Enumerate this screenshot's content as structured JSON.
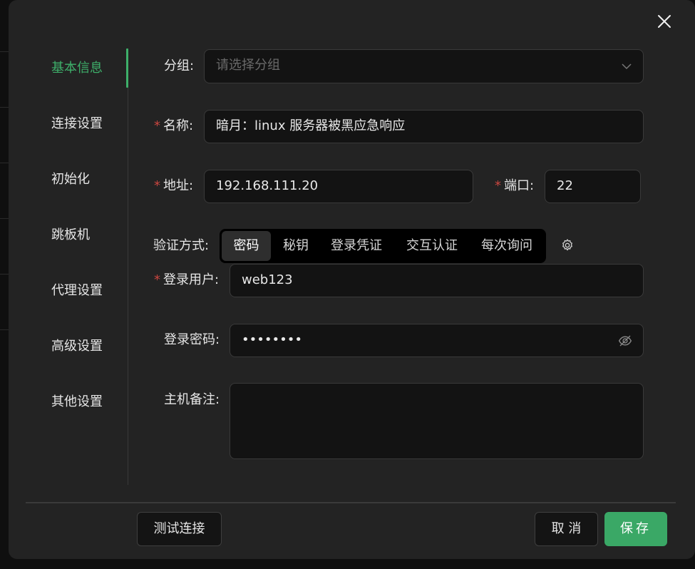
{
  "sidebar": {
    "items": [
      {
        "label": "基本信息",
        "active": true
      },
      {
        "label": "连接设置"
      },
      {
        "label": "初始化"
      },
      {
        "label": "跳板机"
      },
      {
        "label": "代理设置"
      },
      {
        "label": "高级设置"
      },
      {
        "label": "其他设置"
      }
    ]
  },
  "form": {
    "group": {
      "label": "分组:",
      "placeholder": "请选择分组"
    },
    "name": {
      "label": "名称:",
      "value": "暗月：linux 服务器被黑应急响应"
    },
    "address": {
      "label": "地址:",
      "value": "192.168.111.20"
    },
    "port": {
      "label": "端口:",
      "value": "22"
    },
    "auth": {
      "label": "验证方式:",
      "options": [
        "密码",
        "秘钥",
        "登录凭证",
        "交互认证",
        "每次询问"
      ],
      "selected": "密码"
    },
    "user": {
      "label": "登录用户:",
      "value": "web123"
    },
    "password": {
      "label": "登录密码:",
      "value": "••••••••"
    },
    "note": {
      "label": "主机备注:",
      "value": ""
    }
  },
  "footer": {
    "test_label": "测试连接",
    "cancel_label": "取 消",
    "save_label": "保存"
  },
  "colors": {
    "accent": "#3eaf6a",
    "required": "#c9453f",
    "dialog_bg": "#232323",
    "input_bg": "#131313"
  },
  "icons": [
    "close-icon",
    "chevron-down-icon",
    "gear-icon",
    "eye-off-icon",
    "resize-handle-icon"
  ]
}
